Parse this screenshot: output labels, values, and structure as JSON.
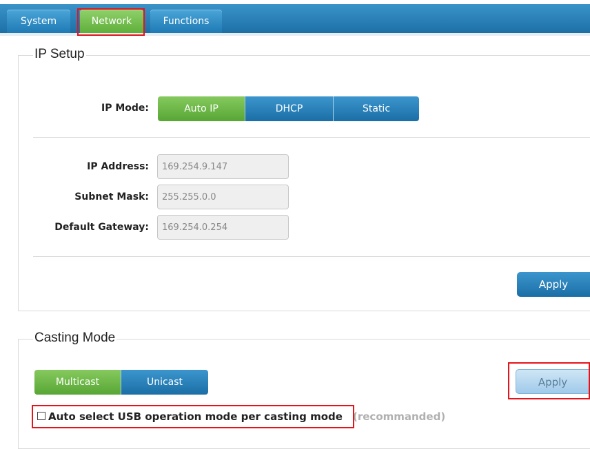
{
  "tabs": [
    {
      "label": "System"
    },
    {
      "label": "Network",
      "active": true
    },
    {
      "label": "Functions"
    }
  ],
  "ip_setup": {
    "title": "IP Setup",
    "mode_label": "IP Mode:",
    "modes": [
      {
        "label": "Auto IP",
        "selected": true
      },
      {
        "label": "DHCP"
      },
      {
        "label": "Static"
      }
    ],
    "fields": [
      {
        "label": "IP Address:",
        "value": "169.254.9.147"
      },
      {
        "label": "Subnet Mask:",
        "value": "255.255.0.0"
      },
      {
        "label": "Default Gateway:",
        "value": "169.254.0.254"
      }
    ],
    "apply_label": "Apply"
  },
  "casting": {
    "title": "Casting Mode",
    "modes": [
      {
        "label": "Multicast",
        "selected": true
      },
      {
        "label": "Unicast"
      }
    ],
    "apply_label": "Apply",
    "checkbox_label": "Auto select USB operation mode per casting mode",
    "checkbox_checked": false,
    "hint": "(recommanded)"
  },
  "colors": {
    "tab_blue": "#2277ae",
    "selected_green": "#5faf3a",
    "highlight_red": "#e3141b"
  }
}
